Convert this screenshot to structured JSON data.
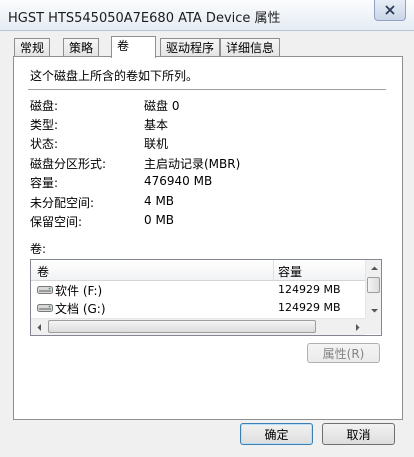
{
  "window": {
    "title": "HGST HTS545050A7E680 ATA Device 属性"
  },
  "tabs": [
    {
      "label": "常规",
      "active": false
    },
    {
      "label": "策略",
      "active": false
    },
    {
      "label": "卷",
      "active": true
    },
    {
      "label": "驱动程序",
      "active": false
    },
    {
      "label": "详细信息",
      "active": false
    }
  ],
  "panel": {
    "intro": "这个磁盘上所含的卷如下所列。",
    "properties": [
      {
        "label": "磁盘:",
        "value": "磁盘 0"
      },
      {
        "label": "类型:",
        "value": "基本"
      },
      {
        "label": "状态:",
        "value": "联机"
      },
      {
        "label": "磁盘分区形式:",
        "value": "主启动记录(MBR)"
      },
      {
        "label": "容量:",
        "value": "476940 MB"
      },
      {
        "label": "未分配空间:",
        "value": "4 MB"
      },
      {
        "label": "保留空间:",
        "value": "0 MB"
      }
    ],
    "volumes_label": "卷:",
    "volume_list": {
      "columns": [
        "卷",
        "容量"
      ],
      "rows": [
        {
          "name": "软件 (F:)",
          "capacity": "124929 MB"
        },
        {
          "name": "文档 (G:)",
          "capacity": "124929 MB"
        }
      ]
    },
    "properties_button": "属性(R)"
  },
  "footer": {
    "ok_label": "确定",
    "cancel_label": "取消"
  }
}
